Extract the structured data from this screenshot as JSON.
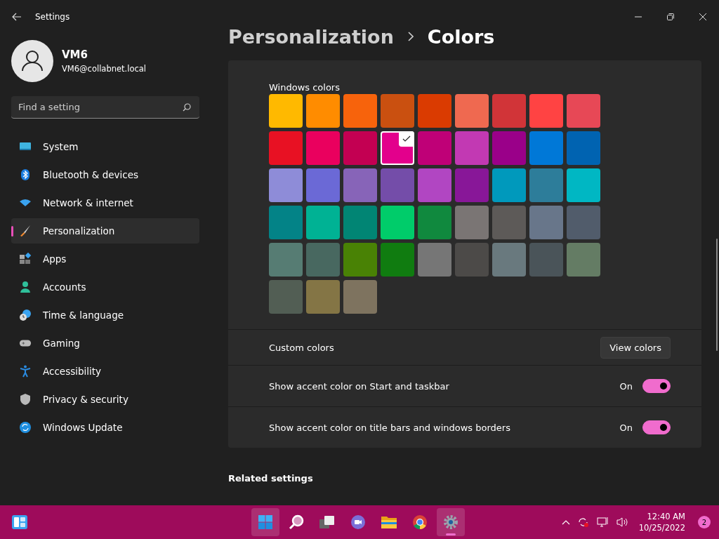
{
  "window": {
    "title": "Settings"
  },
  "user": {
    "name": "VM6",
    "email": "VM6@collabnet.local"
  },
  "search": {
    "placeholder": "Find a setting"
  },
  "sidebar": {
    "items": [
      {
        "label": "System",
        "selected": false
      },
      {
        "label": "Bluetooth & devices",
        "selected": false
      },
      {
        "label": "Network & internet",
        "selected": false
      },
      {
        "label": "Personalization",
        "selected": true
      },
      {
        "label": "Apps",
        "selected": false
      },
      {
        "label": "Accounts",
        "selected": false
      },
      {
        "label": "Time & language",
        "selected": false
      },
      {
        "label": "Gaming",
        "selected": false
      },
      {
        "label": "Accessibility",
        "selected": false
      },
      {
        "label": "Privacy & security",
        "selected": false
      },
      {
        "label": "Windows Update",
        "selected": false
      }
    ]
  },
  "breadcrumb": {
    "parent": "Personalization",
    "current": "Colors"
  },
  "windows_colors": {
    "title": "Windows colors",
    "swatches": [
      {
        "color": "#ffb900",
        "selected": false
      },
      {
        "color": "#ff8c00",
        "selected": false
      },
      {
        "color": "#f7630c",
        "selected": false
      },
      {
        "color": "#ca5010",
        "selected": false
      },
      {
        "color": "#da3b01",
        "selected": false
      },
      {
        "color": "#ef6950",
        "selected": false
      },
      {
        "color": "#d13438",
        "selected": false
      },
      {
        "color": "#ff4343",
        "selected": false
      },
      {
        "color": "#e74856",
        "selected": false
      },
      {
        "color": "#e81123",
        "selected": false
      },
      {
        "color": "#ea005e",
        "selected": false
      },
      {
        "color": "#c30052",
        "selected": false
      },
      {
        "color": "#e3008c",
        "selected": true
      },
      {
        "color": "#bf0077",
        "selected": false
      },
      {
        "color": "#c239b3",
        "selected": false
      },
      {
        "color": "#9a0089",
        "selected": false
      },
      {
        "color": "#0078d7",
        "selected": false
      },
      {
        "color": "#0063b1",
        "selected": false
      },
      {
        "color": "#8e8cd8",
        "selected": false
      },
      {
        "color": "#6b69d6",
        "selected": false
      },
      {
        "color": "#8764b8",
        "selected": false
      },
      {
        "color": "#744da9",
        "selected": false
      },
      {
        "color": "#b146c2",
        "selected": false
      },
      {
        "color": "#881798",
        "selected": false
      },
      {
        "color": "#0099bc",
        "selected": false
      },
      {
        "color": "#2d7d9a",
        "selected": false
      },
      {
        "color": "#00b7c3",
        "selected": false
      },
      {
        "color": "#038387",
        "selected": false
      },
      {
        "color": "#00b294",
        "selected": false
      },
      {
        "color": "#018574",
        "selected": false
      },
      {
        "color": "#00cc6a",
        "selected": false
      },
      {
        "color": "#10893e",
        "selected": false
      },
      {
        "color": "#7a7574",
        "selected": false
      },
      {
        "color": "#5d5a58",
        "selected": false
      },
      {
        "color": "#68768a",
        "selected": false
      },
      {
        "color": "#515c6b",
        "selected": false
      },
      {
        "color": "#567c73",
        "selected": false
      },
      {
        "color": "#486860",
        "selected": false
      },
      {
        "color": "#498205",
        "selected": false
      },
      {
        "color": "#107c10",
        "selected": false
      },
      {
        "color": "#767676",
        "selected": false
      },
      {
        "color": "#4c4a48",
        "selected": false
      },
      {
        "color": "#69797e",
        "selected": false
      },
      {
        "color": "#4a5459",
        "selected": false
      },
      {
        "color": "#647c64",
        "selected": false
      },
      {
        "color": "#525e54",
        "selected": false
      },
      {
        "color": "#847545",
        "selected": false
      },
      {
        "color": "#7e735f",
        "selected": false
      }
    ]
  },
  "custom_colors": {
    "label": "Custom colors",
    "button": "View colors"
  },
  "toggles": [
    {
      "label": "Show accent color on Start and taskbar",
      "state_label": "On",
      "on": true
    },
    {
      "label": "Show accent color on title bars and windows borders",
      "state_label": "On",
      "on": true
    }
  ],
  "related_settings": {
    "title": "Related settings"
  },
  "taskbar": {
    "time": "12:40 AM",
    "date": "10/25/2022",
    "notification_count": "2"
  }
}
